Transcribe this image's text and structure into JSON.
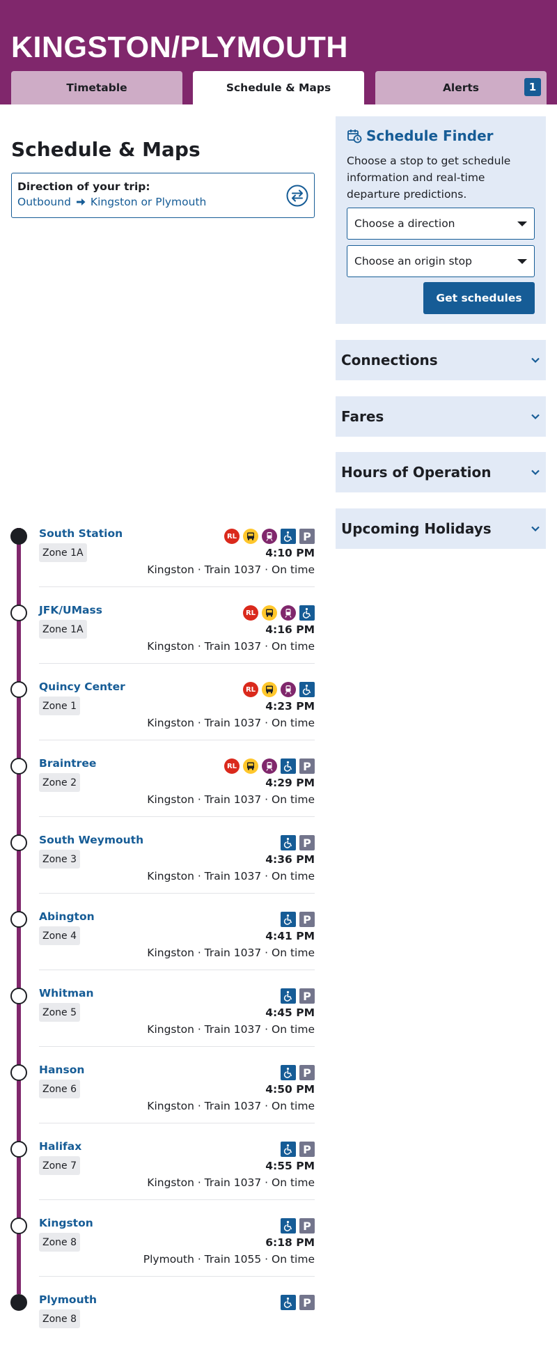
{
  "header": {
    "route_title": "KINGSTON/PLYMOUTH",
    "tabs": [
      {
        "label": "Timetable",
        "active": false
      },
      {
        "label": "Schedule & Maps",
        "active": true
      },
      {
        "label": "Alerts",
        "active": false,
        "badge": "1"
      }
    ]
  },
  "main": {
    "title": "Schedule & Maps",
    "direction": {
      "label": "Direction of your trip:",
      "from": "Outbound",
      "to": "Kingston or Plymouth"
    }
  },
  "stops": [
    {
      "name": "South Station",
      "zone": "Zone 1A",
      "time": "4:10 PM",
      "trip": "Kingston · Train 1037 · On time",
      "terminal": true,
      "icons": [
        "red-line-icon",
        "bus-icon",
        "commuter-rail-icon",
        "accessible-icon",
        "parking-icon"
      ]
    },
    {
      "name": "JFK/UMass",
      "zone": "Zone 1A",
      "time": "4:16 PM",
      "trip": "Kingston · Train 1037 · On time",
      "terminal": false,
      "icons": [
        "red-line-icon",
        "bus-icon",
        "commuter-rail-icon",
        "accessible-icon"
      ]
    },
    {
      "name": "Quincy Center",
      "zone": "Zone 1",
      "time": "4:23 PM",
      "trip": "Kingston · Train 1037 · On time",
      "terminal": false,
      "icons": [
        "red-line-icon",
        "bus-icon",
        "commuter-rail-icon",
        "accessible-icon"
      ]
    },
    {
      "name": "Braintree",
      "zone": "Zone 2",
      "time": "4:29 PM",
      "trip": "Kingston · Train 1037 · On time",
      "terminal": false,
      "icons": [
        "red-line-icon",
        "bus-icon",
        "commuter-rail-icon",
        "accessible-icon",
        "parking-icon"
      ]
    },
    {
      "name": "South Weymouth",
      "zone": "Zone 3",
      "time": "4:36 PM",
      "trip": "Kingston · Train 1037 · On time",
      "terminal": false,
      "icons": [
        "accessible-icon",
        "parking-icon"
      ]
    },
    {
      "name": "Abington",
      "zone": "Zone 4",
      "time": "4:41 PM",
      "trip": "Kingston · Train 1037 · On time",
      "terminal": false,
      "icons": [
        "accessible-icon",
        "parking-icon"
      ]
    },
    {
      "name": "Whitman",
      "zone": "Zone 5",
      "time": "4:45 PM",
      "trip": "Kingston · Train 1037 · On time",
      "terminal": false,
      "icons": [
        "accessible-icon",
        "parking-icon"
      ]
    },
    {
      "name": "Hanson",
      "zone": "Zone 6",
      "time": "4:50 PM",
      "trip": "Kingston · Train 1037 · On time",
      "terminal": false,
      "icons": [
        "accessible-icon",
        "parking-icon"
      ]
    },
    {
      "name": "Halifax",
      "zone": "Zone 7",
      "time": "4:55 PM",
      "trip": "Kingston · Train 1037 · On time",
      "terminal": false,
      "icons": [
        "accessible-icon",
        "parking-icon"
      ]
    },
    {
      "name": "Kingston",
      "zone": "Zone 8",
      "time": "6:18 PM",
      "trip": "Plymouth · Train 1055 · On time",
      "terminal": false,
      "icons": [
        "accessible-icon",
        "parking-icon"
      ]
    },
    {
      "name": "Plymouth",
      "zone": "Zone 8",
      "time": "",
      "trip": "",
      "terminal": true,
      "icons": [
        "accessible-icon",
        "parking-icon"
      ]
    }
  ],
  "icon_labels": {
    "red_line": "RL",
    "parking": "P"
  },
  "finder": {
    "title": "Schedule Finder",
    "description": "Choose a stop to get schedule information and real-time departure predictions.",
    "direction_select": "Choose a direction",
    "origin_select": "Choose an origin stop",
    "button": "Get schedules"
  },
  "accordions": [
    "Connections",
    "Fares",
    "Hours of Operation",
    "Upcoming Holidays"
  ],
  "colors": {
    "route_purple": "#80276c",
    "link_blue": "#165c96",
    "panel_bg": "#e2eaf6",
    "red_line": "#da291c",
    "bus_yellow": "#ffc72c"
  }
}
